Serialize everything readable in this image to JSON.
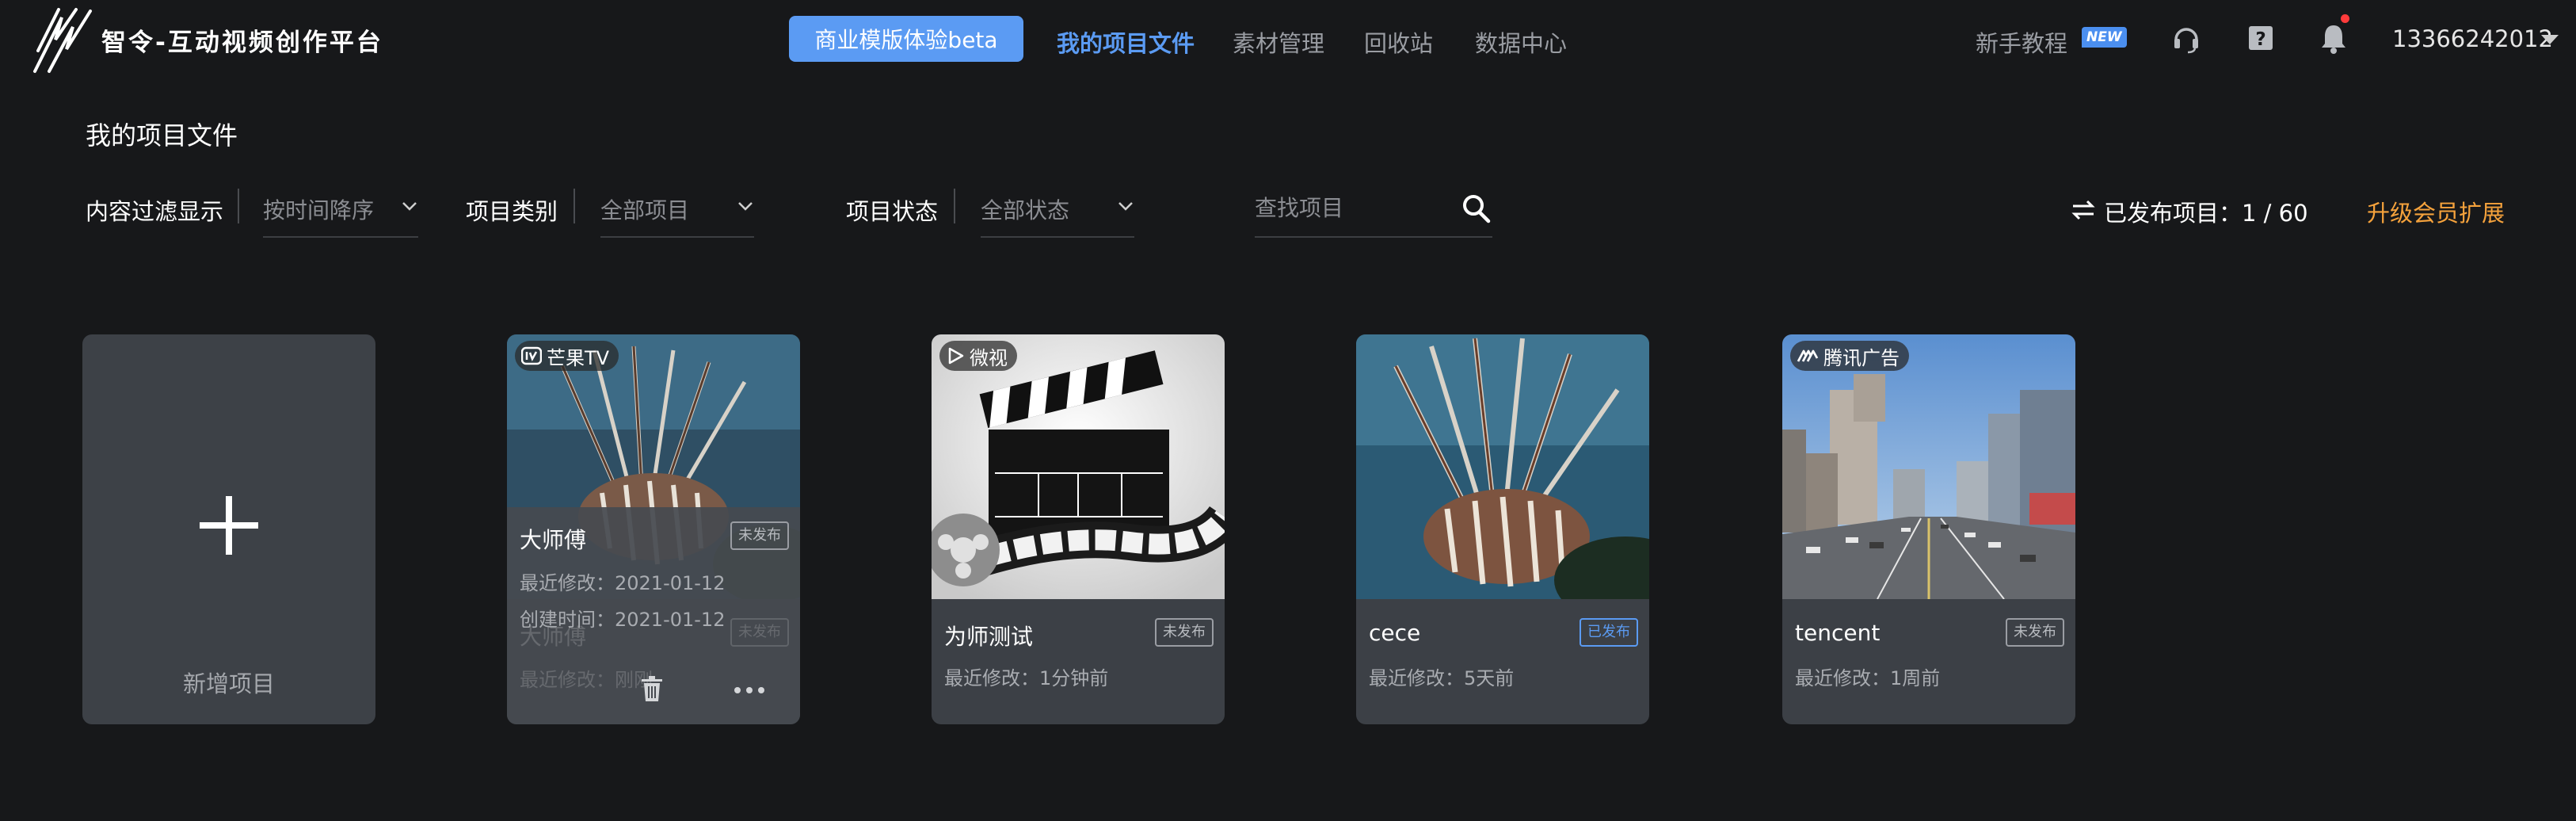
{
  "header": {
    "logo_text": "智令-互动视频创作平台",
    "trial_button": "商业模版体验beta",
    "nav": [
      {
        "label": "我的项目文件",
        "active": true
      },
      {
        "label": "素材管理",
        "active": false
      },
      {
        "label": "回收站",
        "active": false
      },
      {
        "label": "数据中心",
        "active": false
      }
    ],
    "tutorial": "新手教程",
    "new_badge": "NEW",
    "icons": [
      "headset-icon",
      "help-icon",
      "bell-icon"
    ],
    "username": "13366242012"
  },
  "page_title": "我的项目文件",
  "filters": {
    "display_label": "内容过滤显示",
    "sort_value": "按时间降序",
    "type_label": "项目类别",
    "type_value": "全部项目",
    "status_label": "项目状态",
    "status_value": "全部状态",
    "search_placeholder": "查找项目",
    "published": "已发布项目：1 / 60",
    "upgrade": "升级会员扩展"
  },
  "new_project_label": "新增项目",
  "cards": [
    {
      "platform": "芒果TV",
      "title": "大师傅",
      "status": "未发布",
      "modified": "最近修改：2021-01-12",
      "created": "创建时间：2021-01-12",
      "ghost_title": "大师傅",
      "ghost_status": "未发布",
      "ghost_modified": "最近修改：刚刚"
    },
    {
      "platform": "微视",
      "title": "为师测试",
      "status": "未发布",
      "modified": "最近修改：1分钟前"
    },
    {
      "platform": "",
      "title": "cece",
      "status": "已发布",
      "modified": "最近修改：5天前"
    },
    {
      "platform": "腾讯广告",
      "title": "tencent",
      "status": "未发布",
      "modified": "最近修改：1周前"
    }
  ],
  "colors": {
    "background": "#17181a",
    "accent": "#5b9bf3",
    "upgrade": "#f5a23c",
    "card": "#3c4046"
  }
}
